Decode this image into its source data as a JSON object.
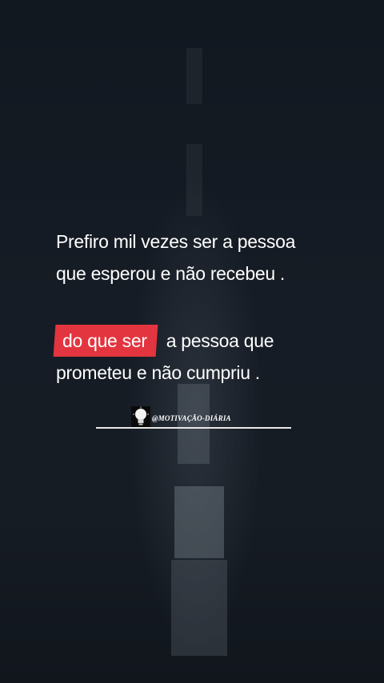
{
  "quote": {
    "line1": "Prefiro mil vezes ser a pessoa",
    "line2": "que esperou e não recebeu  .",
    "highlight": "do que ser",
    "line3_rest": "a pessoa que",
    "line4": "prometeu e não cumpriu ."
  },
  "brand": {
    "handle": "@MOTIVAÇÃO-DIÁRIA",
    "icon": "lightbulb-icon"
  },
  "colors": {
    "background": "#141a22",
    "highlight": "#e3353f",
    "text": "#ffffff"
  }
}
